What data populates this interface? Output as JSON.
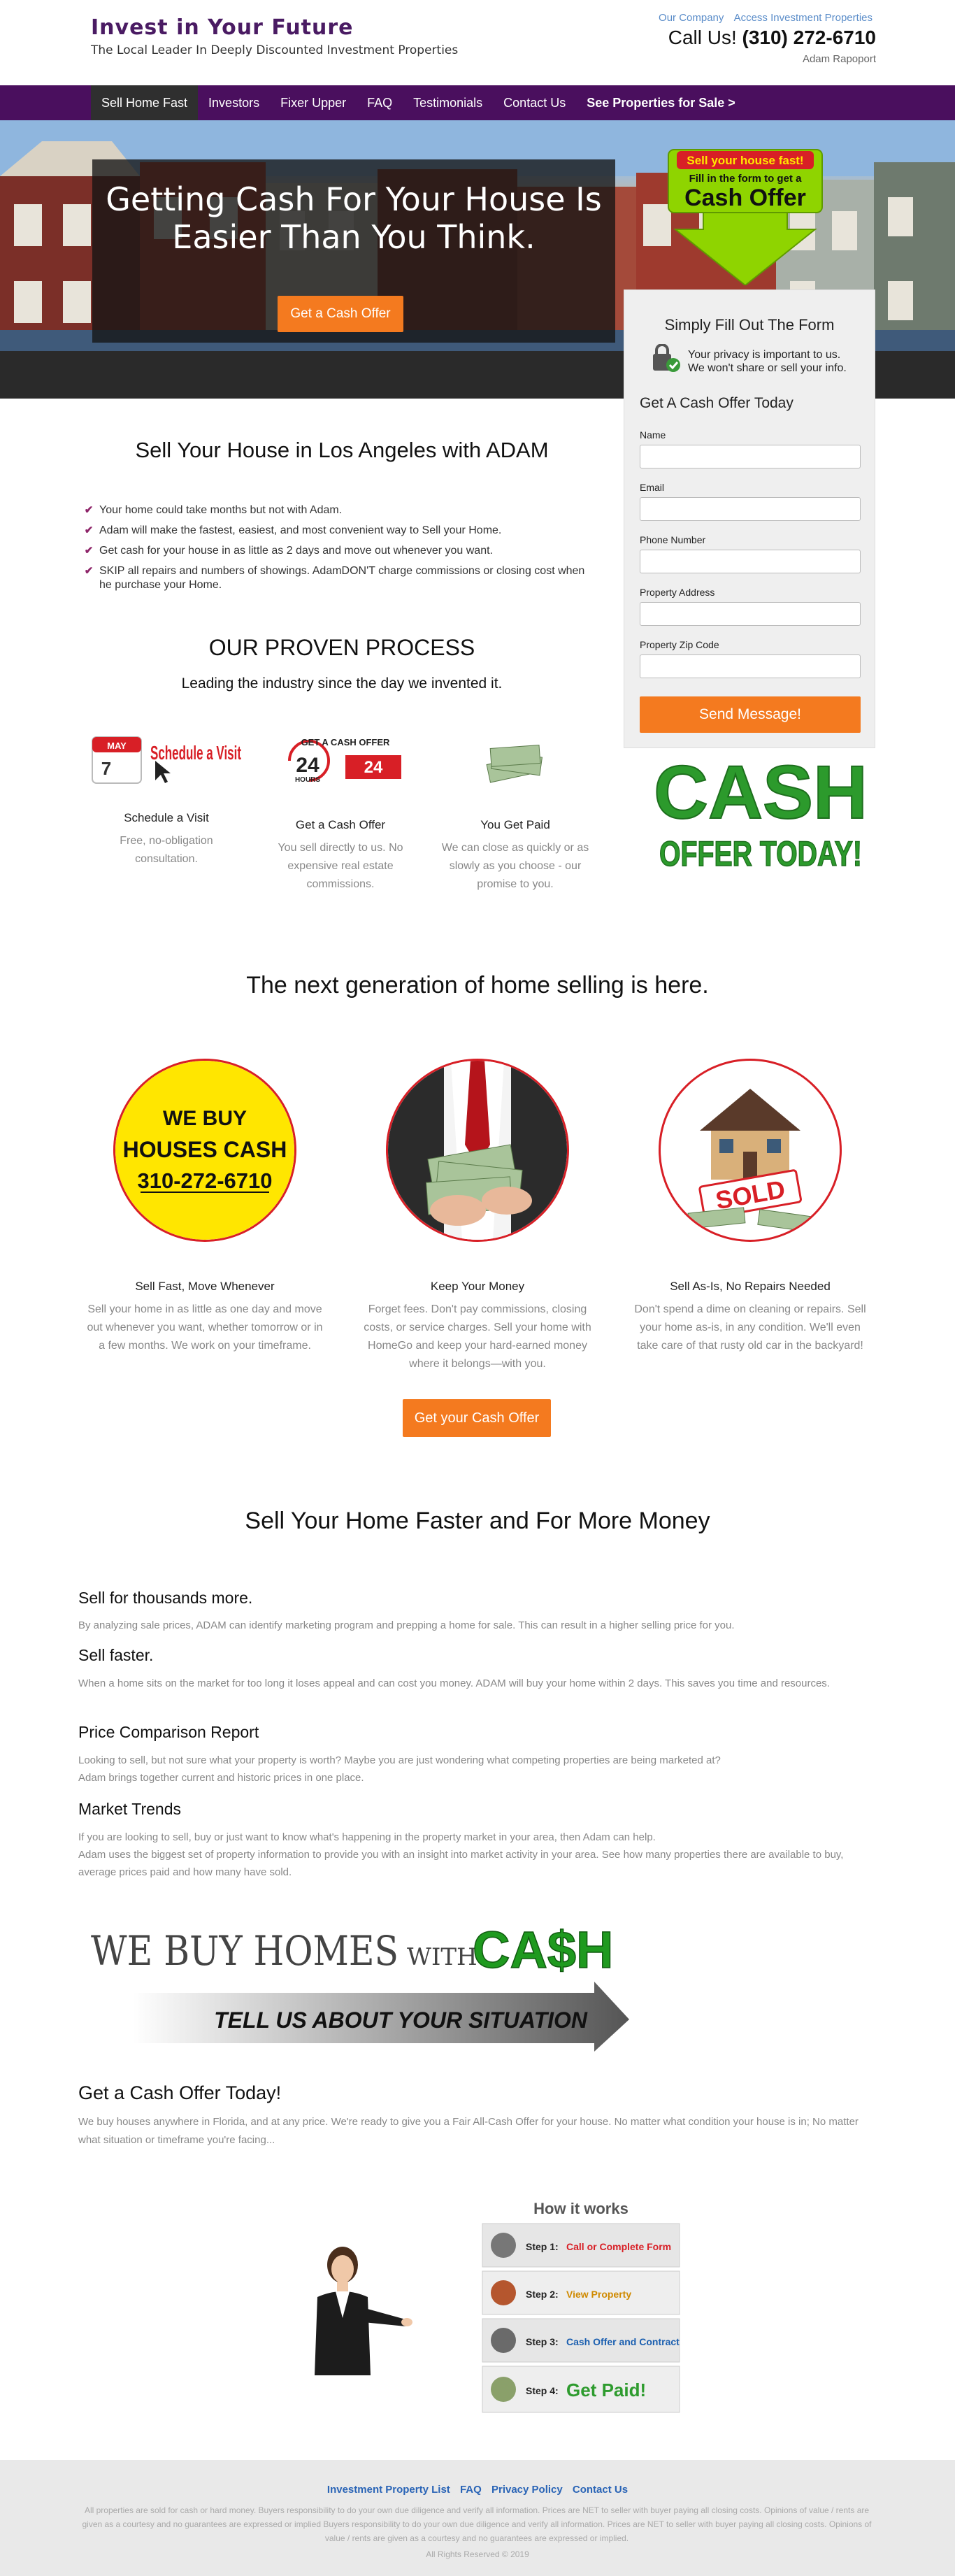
{
  "header": {
    "brand_title": "Invest in Your Future",
    "tagline": "The Local Leader In Deeply Discounted Investment Properties",
    "top_links": [
      "Our Company",
      "Access Investment Properties"
    ],
    "call_prefix": "Call Us!",
    "phone": "(310) 272-6710",
    "agent_name": "Adam Rapoport"
  },
  "nav": {
    "items": [
      "Sell Home Fast",
      "Investors",
      "Fixer Upper",
      "FAQ",
      "Testimonials",
      "Contact Us",
      "See Properties for Sale >"
    ],
    "active_index": 0
  },
  "hero": {
    "heading_line1": "Getting Cash For Your House Is",
    "heading_line2": "Easier Than You Think.",
    "cta_label": "Get a Cash Offer",
    "badge_line1": "Sell your house fast!",
    "badge_line2": "Fill in the form to get a",
    "badge_line3": "Cash Offer"
  },
  "form": {
    "title": "Simply Fill Out The Form",
    "privacy_line1": "Your privacy is important to us.",
    "privacy_line2": "We won't share or sell your info.",
    "subtitle": "Get A Cash Offer Today",
    "fields": [
      "Name",
      "Email",
      "Phone Number",
      "Property Address",
      "Property Zip Code"
    ],
    "submit_label": "Send Message!"
  },
  "cash_offer_image": {
    "line1": "CASH",
    "line2": "OFFER TODAY!"
  },
  "intro": {
    "title": "Sell Your House in Los Angeles with ADAM",
    "checklist": [
      "Your home could take months but not with Adam.",
      "Adam will make the fastest, easiest, and most convenient way to Sell your Home.",
      "Get cash for your house in as little as 2 days and move out whenever you want.",
      "SKIP all repairs and numbers of showings. AdamDON'T charge commissions or closing cost when he purchase your Home."
    ]
  },
  "process": {
    "title": "OUR PROVEN PROCESS",
    "subtitle": "Leading the industry since the day we invented it.",
    "steps": [
      {
        "title": "Schedule a Visit",
        "desc": "Free, no-obligation consultation.",
        "img_text": "Schedule a Visit",
        "img_month": "MAY",
        "img_day": "7"
      },
      {
        "title": "Get a Cash Offer",
        "desc": "You sell directly to us. No expensive real estate commissions.",
        "img_text": "GET A CASH OFFER",
        "img_hours": "24",
        "img_hours_label": "HOURS"
      },
      {
        "title": "You Get Paid",
        "desc": "We can close as quickly or as slowly as you choose - our promise to you."
      }
    ]
  },
  "nextgen": {
    "title": "The next generation of home selling is here.",
    "circle1_lines": [
      "WE BUY",
      "HOUSES CASH",
      "310-272-6710"
    ],
    "sold_label": "SOLD",
    "cards": [
      {
        "title": "Sell Fast, Move Whenever",
        "desc": "Sell your home in as little as one day and move out whenever you want, whether tomorrow or in a few months. We work on your timeframe."
      },
      {
        "title": "Keep Your Money",
        "desc": "Forget fees. Don't pay commissions, closing costs, or service charges. Sell your home with HomeGo and keep your hard-earned money where it belongs—with you."
      },
      {
        "title": "Sell As-Is, No Repairs Needed",
        "desc": "Don't spend a dime on cleaning or repairs. Sell your home as-is, in any condition. We'll even take care of that rusty old car in the backyard!"
      }
    ],
    "cta_label": "Get your Cash Offer"
  },
  "faster": {
    "title": "Sell Your Home Faster and For More Money",
    "items": [
      {
        "head": "Sell for thousands more.",
        "body": [
          "By analyzing sale prices, ADAM can identify marketing program and prepping a home for sale. This can result in a higher selling price for you."
        ]
      },
      {
        "head": "Sell faster.",
        "body": [
          "When a home sits on the market for too long it loses appeal and can cost you money. ADAM will buy your home within 2 days. This saves you time and resources."
        ]
      },
      {
        "head": "Price Comparison Report",
        "body": [
          "Looking to sell, but not sure what your property is worth? Maybe you are just wondering what competing properties are being marketed at?",
          "Adam brings together current and historic prices in one place."
        ]
      },
      {
        "head": "Market Trends",
        "body": [
          "If you are looking to sell, buy or just want to know what's happening in the property market in your area, then Adam can help.",
          "Adam uses the biggest set of property information to provide you with an insight into market activity in your area. See how many properties there are available to buy, average prices paid and how many have sold."
        ]
      }
    ]
  },
  "banner": {
    "line_we": "WE BUY HOMES",
    "line_with": "WITH",
    "line_cash": "CA$H",
    "tell": "TELL US ABOUT YOUR SITUATION"
  },
  "offer": {
    "title": "Get a Cash Offer Today!",
    "body": "We buy houses anywhere in Florida, and at any price. We're ready to give you a Fair All-Cash Offer for your house. No matter what condition your house is in; No matter what situation or timeframe you're facing..."
  },
  "how": {
    "title": "How it works",
    "steps": [
      {
        "prefix": "Step 1:",
        "text": "Call or Complete Form",
        "color": "#d81f26"
      },
      {
        "prefix": "Step 2:",
        "text": "View Property",
        "color": "#d08a00"
      },
      {
        "prefix": "Step 3:",
        "text": "Cash Offer and Contract",
        "color": "#1b5fb0"
      },
      {
        "prefix": "Step 4:",
        "text": "Get Paid!",
        "color": "#2e9b2e"
      }
    ]
  },
  "footer": {
    "links": [
      "Investment Property List",
      "FAQ",
      "Privacy Policy",
      "Contact Us"
    ],
    "disclaimer": "All properties are sold for cash or hard money. Buyers responsibility to do your own due diligence and verify all information. Prices are NET to seller with buyer paying all closing costs. Opinions of value / rents are given as a courtesy and no guarantees are expressed or implied Buyers responsibility to do your own due diligence and verify all information. Prices are NET to seller with buyer paying all closing costs. Opinions of value / rents are given as a courtesy and no guarantees are expressed or implied.",
    "rights": "All Rights Reserved © 2019"
  },
  "colors": {
    "brand_purple": "#4a0f5e",
    "accent_orange": "#f47a1f",
    "link_blue": "#2a64b6",
    "check_magenta": "#8e2469"
  }
}
